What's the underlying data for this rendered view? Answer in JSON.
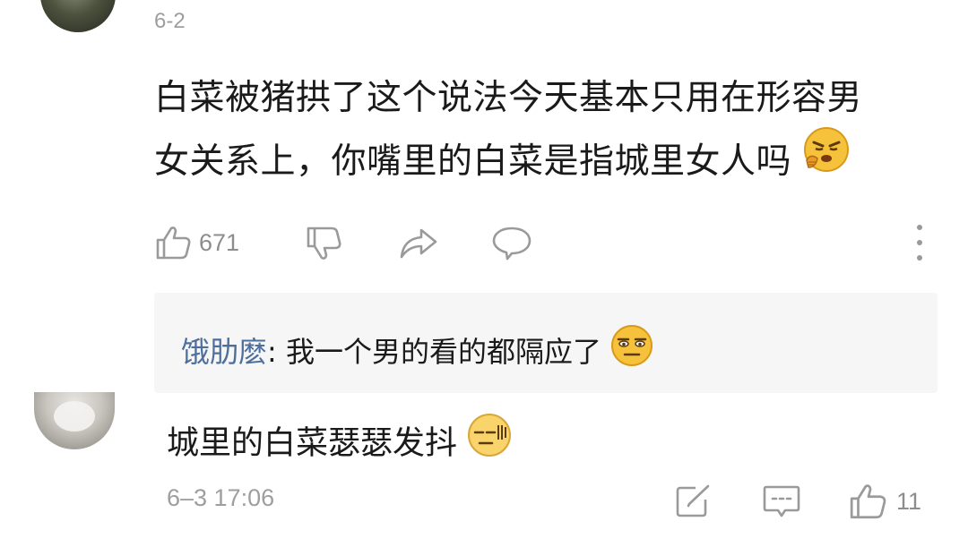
{
  "comment1": {
    "date": "6-2",
    "text_line1": "白菜被猪拱了这个说法今天基本只用在形容男",
    "text_line2": "女关系上，你嘴里的白菜是指城里女人吗",
    "like_count": "671"
  },
  "reply_preview": {
    "user": "饿肋麽",
    "separator": ": ",
    "text": "我一个男的看的都隔应了"
  },
  "comment2": {
    "text": "城里的白菜瑟瑟发抖",
    "timestamp": "6–3 17:06",
    "like_count": "11"
  },
  "colors": {
    "username": "#4e6f9d",
    "meta_gray": "#9e9e9e",
    "icon_gray": "#8d8d8d",
    "reply_bg": "#f6f6f6"
  },
  "icons": [
    "thumb-up-icon",
    "thumb-down-icon",
    "share-icon",
    "comment-icon",
    "more-icon",
    "edit-icon",
    "message-icon"
  ]
}
